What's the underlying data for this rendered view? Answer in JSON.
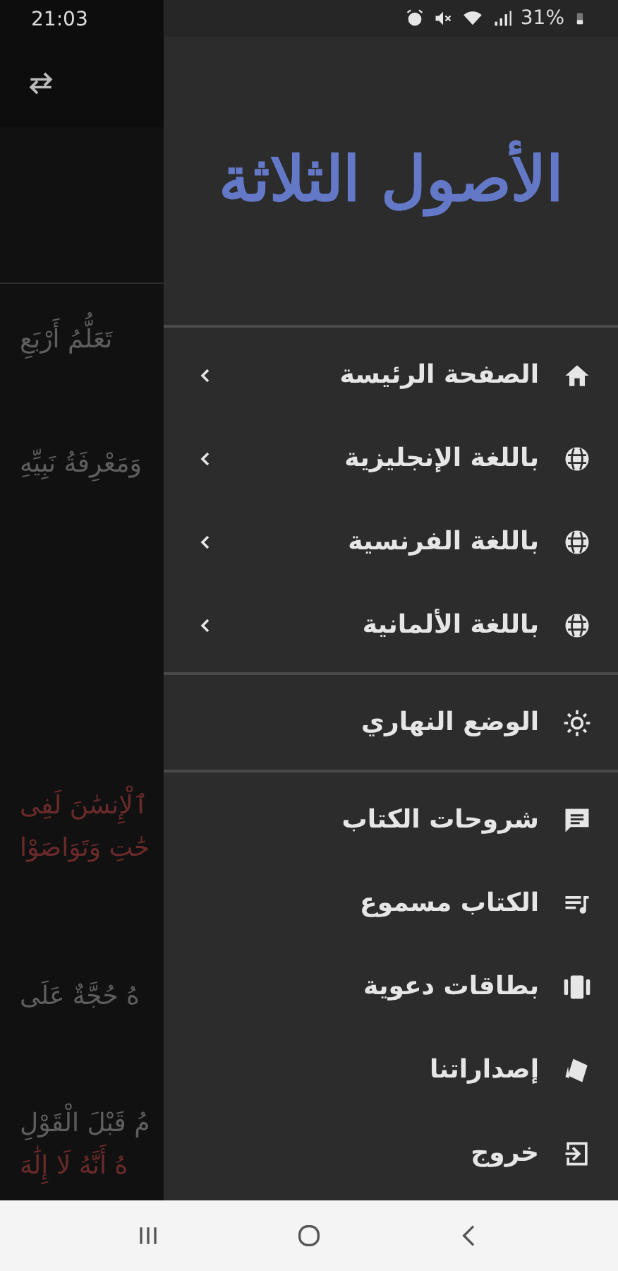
{
  "status_bar": {
    "time": "21:03",
    "battery": "31%"
  },
  "background_lines": [
    {
      "text": "تَعَلُّمُ أَرْبَعِ",
      "kind": "plain"
    },
    {
      "text": "وَمَعْرِفَةُ نَبِيِّهِ",
      "kind": "plain"
    },
    {
      "text": "ٱلْإِنسَٰنَ لَفِى",
      "kind": "highlight"
    },
    {
      "text": "حَٰتِ وَتَوَاصَوْا",
      "kind": "highlight"
    },
    {
      "text": "هُ حُجَّةٌ عَلَى",
      "kind": "plain"
    },
    {
      "text": "مُ قَبْلَ الْقَوْلِ",
      "kind": "plain"
    },
    {
      "text": "هُ أَنَّهُ لَا إِلَٰهَ",
      "kind": "highlight"
    }
  ],
  "drawer": {
    "logo": "الأصول الثلاثة",
    "groups": [
      [
        {
          "label": "الصفحة الرئيسة",
          "kind": "home",
          "expandable": true
        },
        {
          "label": "باللغة الإنجليزية",
          "kind": "language",
          "expandable": true
        },
        {
          "label": "باللغة الفرنسية",
          "kind": "language",
          "expandable": true
        },
        {
          "label": "باللغة الألمانية",
          "kind": "language",
          "expandable": true
        }
      ],
      [
        {
          "label": "الوضع النهاري",
          "kind": "theme"
        }
      ],
      [
        {
          "label": "شروحات الكتاب",
          "kind": "commentary"
        },
        {
          "label": "الكتاب مسموع",
          "kind": "audio"
        },
        {
          "label": "بطاقات دعوية",
          "kind": "cards"
        },
        {
          "label": "إصداراتنا",
          "kind": "releases"
        },
        {
          "label": "خروج",
          "kind": "exit"
        }
      ]
    ]
  }
}
